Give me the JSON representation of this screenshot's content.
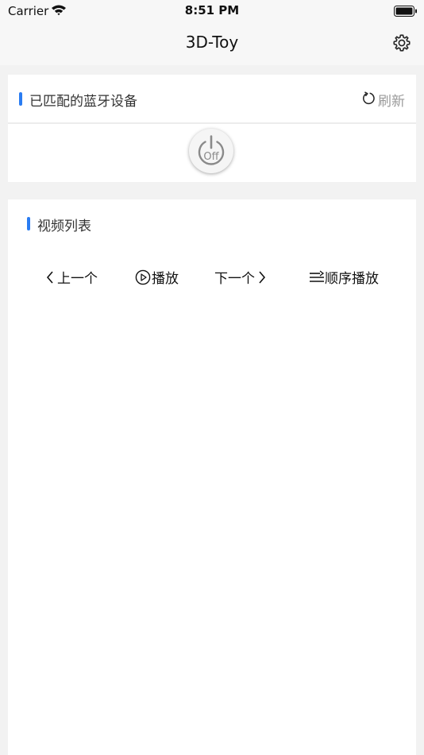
{
  "status_bar": {
    "carrier": "Carrier",
    "time": "8:51 PM"
  },
  "nav": {
    "title": "3D-Toy",
    "settings_icon": "gear-icon"
  },
  "devices": {
    "title": "已匹配的蓝牙设备",
    "refresh_label": "刷新",
    "refresh_icon": "refresh-icon",
    "power_label": "Off",
    "accent_color": "#2a7cf2"
  },
  "videos": {
    "title": "视频列表",
    "controls": {
      "prev_label": "上一个",
      "play_label": "播放",
      "next_label": "下一个",
      "order_label": "顺序播放"
    }
  }
}
